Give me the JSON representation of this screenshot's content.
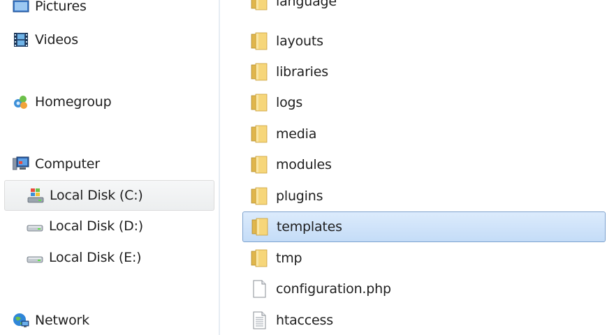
{
  "navigation": {
    "libraries": [
      {
        "label": "Pictures",
        "icon": "pictures-library-icon"
      },
      {
        "label": "Videos",
        "icon": "videos-library-icon"
      }
    ],
    "homegroup": {
      "label": "Homegroup",
      "icon": "homegroup-icon"
    },
    "computer": {
      "label": "Computer",
      "icon": "computer-icon",
      "drives": [
        {
          "label": "Local Disk (C:)",
          "icon": "windows-drive-icon",
          "selected": true
        },
        {
          "label": "Local Disk (D:)",
          "icon": "hard-drive-icon",
          "selected": false
        },
        {
          "label": "Local Disk (E:)",
          "icon": "hard-drive-icon",
          "selected": false
        }
      ]
    },
    "network": {
      "label": "Network",
      "icon": "network-icon"
    }
  },
  "files": [
    {
      "name": "language",
      "type": "folder",
      "partially_visible": true
    },
    {
      "name": "layouts",
      "type": "folder"
    },
    {
      "name": "libraries",
      "type": "folder"
    },
    {
      "name": "logs",
      "type": "folder"
    },
    {
      "name": "media",
      "type": "folder"
    },
    {
      "name": "modules",
      "type": "folder"
    },
    {
      "name": "plugins",
      "type": "folder"
    },
    {
      "name": "templates",
      "type": "folder",
      "selected": true
    },
    {
      "name": "tmp",
      "type": "folder"
    },
    {
      "name": "configuration.php",
      "type": "file"
    },
    {
      "name": "htaccess",
      "type": "text-file"
    }
  ],
  "colors": {
    "selection_fill": "#cde2f8",
    "selection_border": "#7da2ce",
    "nav_selection_fill": "#eceeef",
    "folder_yellow": "#f2cf6b"
  }
}
